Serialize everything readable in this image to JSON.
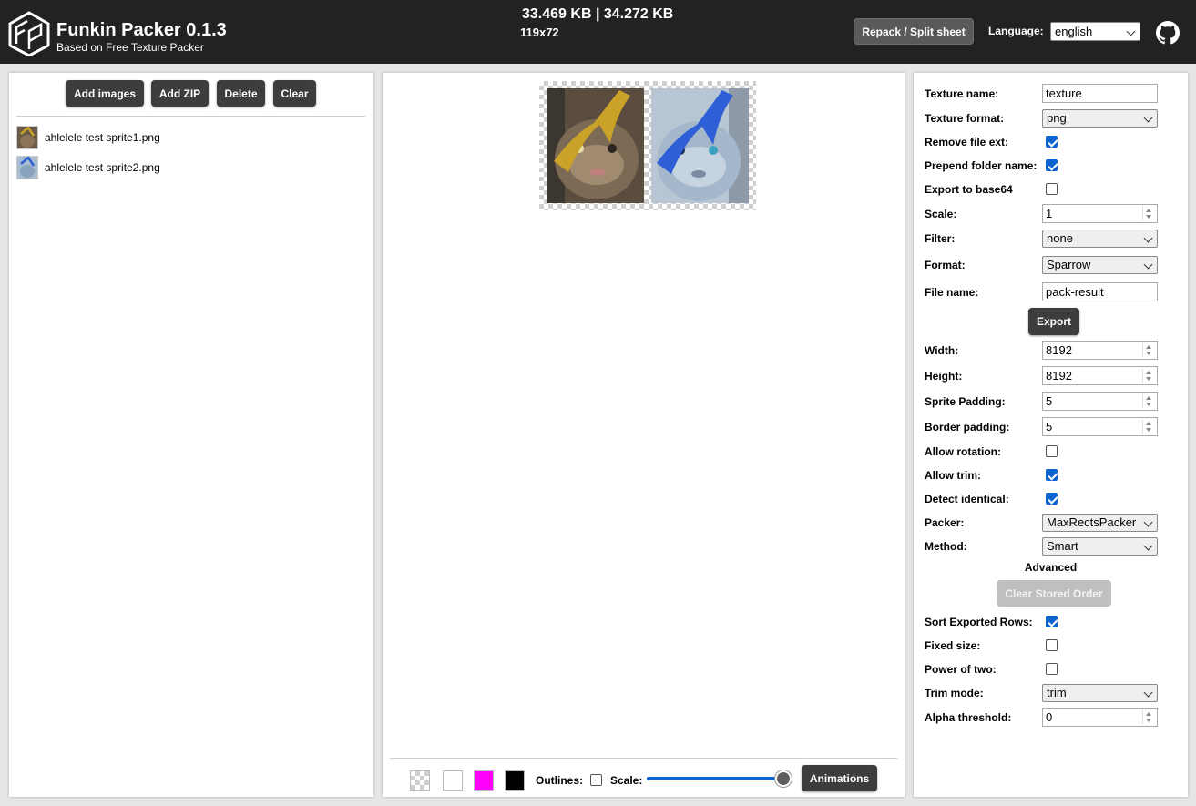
{
  "header": {
    "title": "Funkin Packer 0.1.3",
    "subtitle": "Based on Free Texture Packer",
    "sizes": "33.469 KB | 34.272 KB",
    "dims": "119x72",
    "repack_label": "Repack / Split sheet",
    "language_label": "Language:",
    "language_value": "english"
  },
  "left": {
    "buttons": {
      "add_images": "Add images",
      "add_zip": "Add ZIP",
      "delete": "Delete",
      "clear": "Clear"
    },
    "files": [
      {
        "name": "ahlelele test sprite1.png",
        "tint": "#c9a227"
      },
      {
        "name": "ahlelele test sprite2.png",
        "tint": "#2f5fd6"
      }
    ]
  },
  "center": {
    "bg_swatches": [
      "checker",
      "#ffffff",
      "#ff00ff",
      "#000000"
    ],
    "outlines_label": "Outlines:",
    "outlines_checked": false,
    "scale_label": "Scale:",
    "scale_value": 1.0,
    "animations_label": "Animations"
  },
  "right": {
    "texture_name": {
      "label": "Texture name:",
      "value": "texture"
    },
    "texture_format": {
      "label": "Texture format:",
      "value": "png"
    },
    "remove_file_ext": {
      "label": "Remove file ext:",
      "checked": true
    },
    "prepend_folder": {
      "label": "Prepend folder name:",
      "checked": true
    },
    "export_base64": {
      "label": "Export to base64",
      "checked": false
    },
    "scale": {
      "label": "Scale:",
      "value": "1"
    },
    "filter": {
      "label": "Filter:",
      "value": "none"
    },
    "format": {
      "label": "Format:",
      "value": "Sparrow"
    },
    "file_name": {
      "label": "File name:",
      "value": "pack-result"
    },
    "export_label": "Export",
    "width": {
      "label": "Width:",
      "value": "8192"
    },
    "height": {
      "label": "Height:",
      "value": "8192"
    },
    "sprite_padding": {
      "label": "Sprite Padding:",
      "value": "5"
    },
    "border_padding": {
      "label": "Border padding:",
      "value": "5"
    },
    "allow_rotation": {
      "label": "Allow rotation:",
      "checked": false
    },
    "allow_trim": {
      "label": "Allow trim:",
      "checked": true
    },
    "detect_identical": {
      "label": "Detect identical:",
      "checked": true
    },
    "packer": {
      "label": "Packer:",
      "value": "MaxRectsPacker"
    },
    "method": {
      "label": "Method:",
      "value": "Smart"
    },
    "advanced_label": "Advanced",
    "clear_stored_label": "Clear Stored Order",
    "sort_exported": {
      "label": "Sort Exported Rows:",
      "checked": true
    },
    "fixed_size": {
      "label": "Fixed size:",
      "checked": false
    },
    "power_of_two": {
      "label": "Power of two:",
      "checked": false
    },
    "trim_mode": {
      "label": "Trim mode:",
      "value": "trim"
    },
    "alpha_threshold": {
      "label": "Alpha threshold:",
      "value": "0"
    }
  }
}
